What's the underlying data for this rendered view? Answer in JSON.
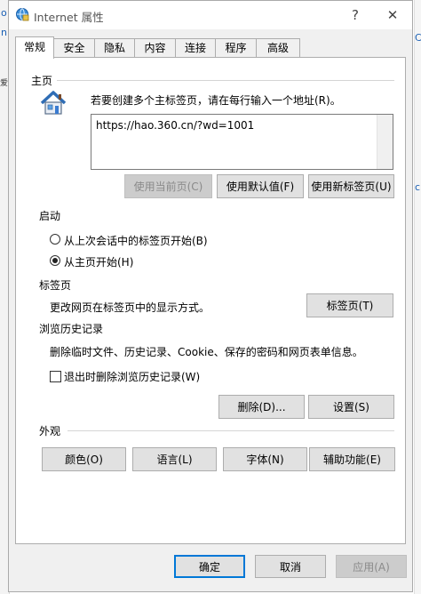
{
  "window": {
    "title": "Internet 属性"
  },
  "backdrop": {
    "left_glyphs": [
      "o",
      "n",
      "爱"
    ],
    "right_glyphs": [
      "C",
      "c"
    ]
  },
  "tabs": [
    {
      "label": "常规",
      "active": true
    },
    {
      "label": "安全"
    },
    {
      "label": "隐私"
    },
    {
      "label": "内容"
    },
    {
      "label": "连接"
    },
    {
      "label": "程序"
    },
    {
      "label": "高级"
    }
  ],
  "home": {
    "heading": "主页",
    "description": "若要创建多个主标签页，请在每行输入一个地址(R)。",
    "url": "https://hao.360.cn/?wd=1001",
    "use_current": "使用当前页(C)",
    "use_default": "使用默认值(F)",
    "use_new_tab": "使用新标签页(U)"
  },
  "startup": {
    "heading": "启动",
    "option_last_session": "从上次会话中的标签页开始(B)",
    "option_home": "从主页开始(H)",
    "selected": "home"
  },
  "tabs_section": {
    "heading": "标签页",
    "description": "更改网页在标签页中的显示方式。",
    "button": "标签页(T)"
  },
  "history": {
    "heading": "浏览历史记录",
    "description": "删除临时文件、历史记录、Cookie、保存的密码和网页表单信息。",
    "checkbox_label": "退出时删除浏览历史记录(W)",
    "checked": false,
    "delete_button": "删除(D)...",
    "settings_button": "设置(S)"
  },
  "appearance": {
    "heading": "外观",
    "colors": "颜色(O)",
    "languages": "语言(L)",
    "fonts": "字体(N)",
    "accessibility": "辅助功能(E)"
  },
  "footer": {
    "ok": "确定",
    "cancel": "取消",
    "apply": "应用(A)"
  },
  "icons": {
    "minimize": "minimize-icon",
    "close": "close-icon",
    "app": "ie-globe-icon",
    "home": "house-icon"
  }
}
